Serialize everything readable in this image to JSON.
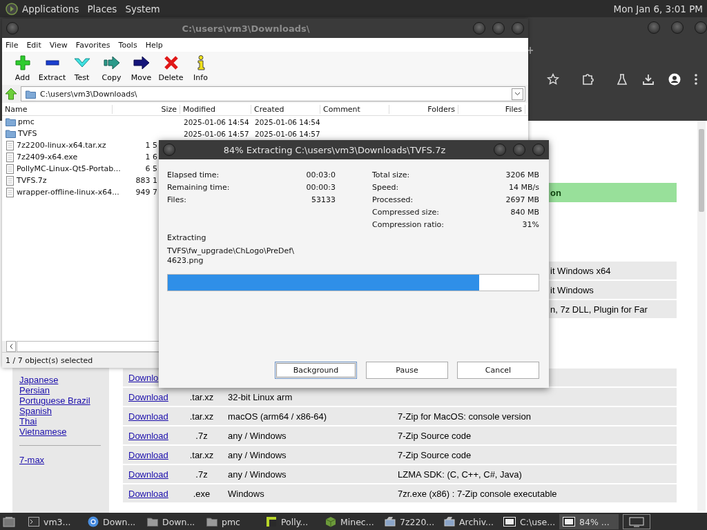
{
  "top_panel": {
    "menus": [
      "Applications",
      "Places",
      "System"
    ],
    "clock": "Mon Jan 6, 3:01 PM"
  },
  "browser": {
    "sidebar": {
      "languages": [
        "Japanese",
        "Persian",
        "Portuguese Brazil",
        "Spanish",
        "Thai",
        "Vietnamese"
      ],
      "extra_links": [
        "7-max"
      ]
    },
    "table_rows": [
      {
        "kind": "header",
        "description": "on"
      },
      {
        "kind": "partial",
        "description": "it Windows x64"
      },
      {
        "kind": "partial",
        "description": "it Windows"
      },
      {
        "kind": "partial",
        "description": "n, 7z DLL, Plugin for Far"
      },
      {
        "kind": "full",
        "link": "Downlo"
      },
      {
        "kind": "full",
        "link": "Download",
        "ext": ".tar.xz",
        "platform": "32-bit Linux arm"
      },
      {
        "kind": "full",
        "link": "Download",
        "ext": ".tar.xz",
        "platform": "macOS (arm64 / x86-64)",
        "description": "7-Zip for MacOS: console version"
      },
      {
        "kind": "full",
        "link": "Download",
        "ext": ".7z",
        "platform": "any / Windows",
        "description": "7-Zip Source code"
      },
      {
        "kind": "full",
        "link": "Download",
        "ext": ".tar.xz",
        "platform": "any / Windows",
        "description": "7-Zip Source code"
      },
      {
        "kind": "full",
        "link": "Download",
        "ext": ".7z",
        "platform": "any / Windows",
        "description": "LZMA SDK: (C, C++, C#, Java)"
      },
      {
        "kind": "full",
        "link": "Download",
        "ext": ".exe",
        "platform": "Windows",
        "description": "7zr.exe (x86) : 7-Zip console executable"
      }
    ]
  },
  "file_manager": {
    "title": "C:\\users\\vm3\\Downloads\\",
    "menu": [
      "File",
      "Edit",
      "View",
      "Favorites",
      "Tools",
      "Help"
    ],
    "toolbar": [
      {
        "label": "Add",
        "kind": "add"
      },
      {
        "label": "Extract",
        "kind": "extract"
      },
      {
        "label": "Test",
        "kind": "test"
      },
      {
        "label": "Copy",
        "kind": "copy"
      },
      {
        "label": "Move",
        "kind": "move"
      },
      {
        "label": "Delete",
        "kind": "delete"
      },
      {
        "label": "Info",
        "kind": "info"
      }
    ],
    "path": "C:\\users\\vm3\\Downloads\\",
    "columns": [
      "Name",
      "Size",
      "Modified",
      "Created",
      "Comment",
      "Folders",
      "Files"
    ],
    "rows": [
      {
        "kind": "folder",
        "name": "pmc",
        "modified": "2025-01-06 14:54",
        "created": "2025-01-06 14:54"
      },
      {
        "kind": "folder",
        "name": "TVFS",
        "modified": "2025-01-06 14:57",
        "created": "2025-01-06 14:57"
      },
      {
        "kind": "file",
        "name": "7z2200-linux-x64.tar.xz",
        "size": "1 5"
      },
      {
        "kind": "file",
        "name": "7z2409-x64.exe",
        "size": "1 6"
      },
      {
        "kind": "file",
        "name": "PollyMC-Linux-Qt5-Portab...",
        "size": "6 5"
      },
      {
        "kind": "file",
        "name": "TVFS.7z",
        "size": "883 1"
      },
      {
        "kind": "file",
        "name": "wrapper-offline-linux-x64...",
        "size": "949 7"
      }
    ],
    "status": "1 / 7 object(s) selected"
  },
  "dialog": {
    "title": "84% Extracting C:\\users\\vm3\\Downloads\\TVFS.7z",
    "stats_left": [
      {
        "label": "Elapsed time:",
        "value": "00:03:0"
      },
      {
        "label": "Remaining time:",
        "value": "00:00:3"
      },
      {
        "label": "Files:",
        "value": "53133"
      }
    ],
    "stats_right": [
      {
        "label": "Total size:",
        "value": "3206 MB"
      },
      {
        "label": "Speed:",
        "value": "14 MB/s"
      },
      {
        "label": "Processed:",
        "value": "2697 MB"
      },
      {
        "label": "Compressed size:",
        "value": "840 MB"
      },
      {
        "label": "Compression ratio:",
        "value": "31%"
      }
    ],
    "current_label": "Extracting",
    "current_path_lines": [
      "TVFS\\fw_upgrade\\ChLogo\\PreDef\\",
      "4623.png"
    ],
    "progress": {
      "level": 0.84
    },
    "buttons": [
      {
        "label": "Background",
        "focused": true
      },
      {
        "label": "Pause",
        "focused": false
      },
      {
        "label": "Cancel",
        "focused": false
      }
    ]
  },
  "taskbar": {
    "items": [
      {
        "label": "vm3...",
        "kind": "terminal",
        "selected": false
      },
      {
        "label": "Down...",
        "kind": "browser",
        "selected": false
      },
      {
        "label": "Down...",
        "kind": "folder",
        "selected": false
      },
      {
        "label": "pmc",
        "kind": "folder",
        "selected": false
      },
      {
        "label": "Polly...",
        "kind": "polly",
        "selected": false
      },
      {
        "label": "Minec...",
        "kind": "cube",
        "selected": false
      },
      {
        "label": "7z220...",
        "kind": "archiver",
        "selected": false
      },
      {
        "label": "Archiv...",
        "kind": "archiver",
        "selected": false
      },
      {
        "label": "C:\\use...",
        "kind": "sevenzip",
        "selected": false
      },
      {
        "label": "84% ...",
        "kind": "sevenzip",
        "selected": true
      }
    ]
  }
}
